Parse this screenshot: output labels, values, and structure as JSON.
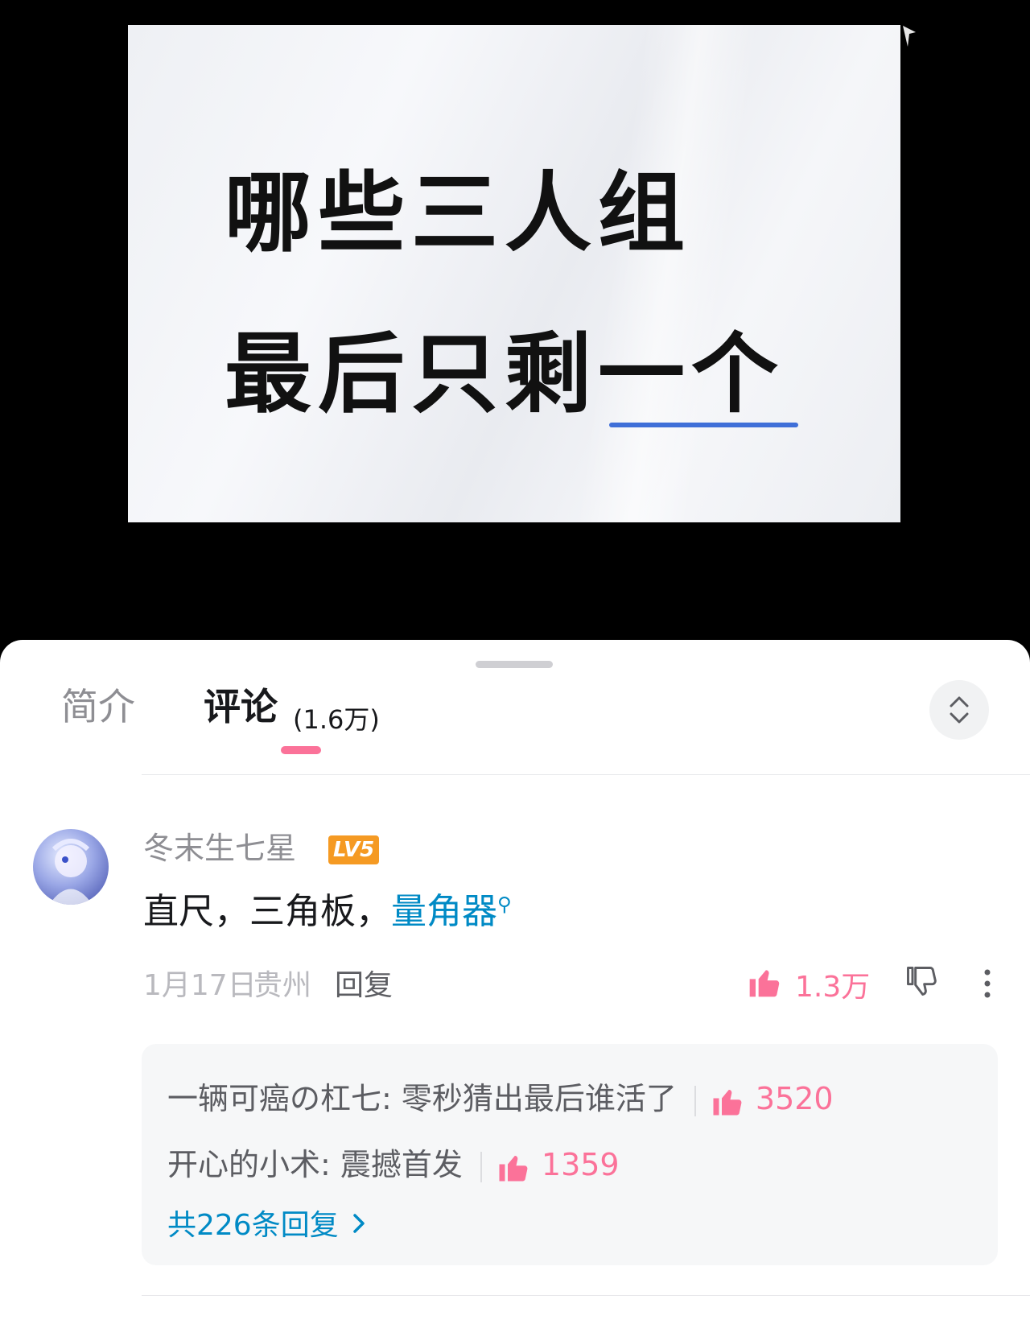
{
  "video": {
    "line1": "哪些三人组",
    "line2": "最后只剩一个"
  },
  "tabs": {
    "intro": "简介",
    "comments": "评论",
    "comment_count": "(1.6万)"
  },
  "comment": {
    "username": "冬末生七星",
    "level": "LV5",
    "text_plain": "直尺，三角板，",
    "text_link": "量角器",
    "date": "1月17日",
    "location": "贵州",
    "reply_label": "回复",
    "like_count": "1.3万"
  },
  "replies": [
    {
      "text": "一辆可癌の杠七: 零秒猜出最后谁活了",
      "likes": "3520"
    },
    {
      "text": "开心的小术: 震撼首发",
      "likes": "1359"
    }
  ],
  "total_replies": "共226条回复",
  "colors": {
    "accent_pink": "#fb7299",
    "link_blue": "#008ac5",
    "level_orange": "#f59a23"
  },
  "icons": {
    "like": "thumbs-up-icon",
    "dislike": "thumbs-down-icon",
    "more": "more-vertical-icon",
    "expand": "expand-collapse-icon",
    "search": "search-icon",
    "chevron": "chevron-right-icon"
  }
}
